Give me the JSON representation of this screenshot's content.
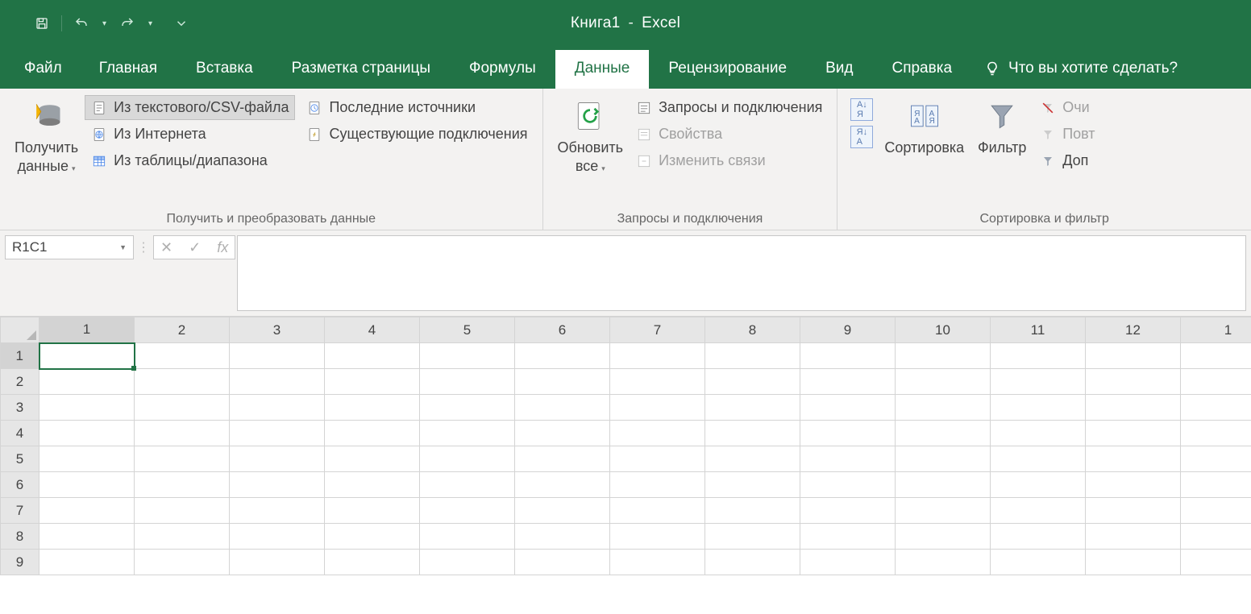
{
  "title": {
    "doc": "Книга1",
    "app": "Excel"
  },
  "tabs": {
    "file": "Файл",
    "home": "Главная",
    "insert": "Вставка",
    "layout": "Разметка страницы",
    "formulas": "Формулы",
    "data": "Данные",
    "review": "Рецензирование",
    "view": "Вид",
    "help": "Справка",
    "tellme": "Что вы хотите сделать?"
  },
  "ribbon": {
    "group1_label": "Получить и преобразовать данные",
    "get_data": "Получить\nданные",
    "from_csv": "Из текстового/CSV-файла",
    "from_web": "Из Интернета",
    "from_table": "Из таблицы/диапазона",
    "recent": "Последние источники",
    "existing": "Существующие подключения",
    "group2_label": "Запросы и подключения",
    "refresh_all": "Обновить\nвсе",
    "queries_conn": "Запросы и подключения",
    "properties": "Свойства",
    "edit_links": "Изменить связи",
    "group3_label": "Сортировка и фильтр",
    "sort": "Сортировка",
    "filter": "Фильтр",
    "clear": "Очи",
    "reapply": "Повт",
    "advanced": "Доп"
  },
  "fbar": {
    "name": "R1C1"
  },
  "grid": {
    "cols": [
      "1",
      "2",
      "3",
      "4",
      "5",
      "6",
      "7",
      "8",
      "9",
      "10",
      "11",
      "12",
      "1"
    ],
    "rows": [
      "1",
      "2",
      "3",
      "4",
      "5",
      "6",
      "7",
      "8",
      "9"
    ],
    "selected_row": 0,
    "selected_col": 0
  }
}
